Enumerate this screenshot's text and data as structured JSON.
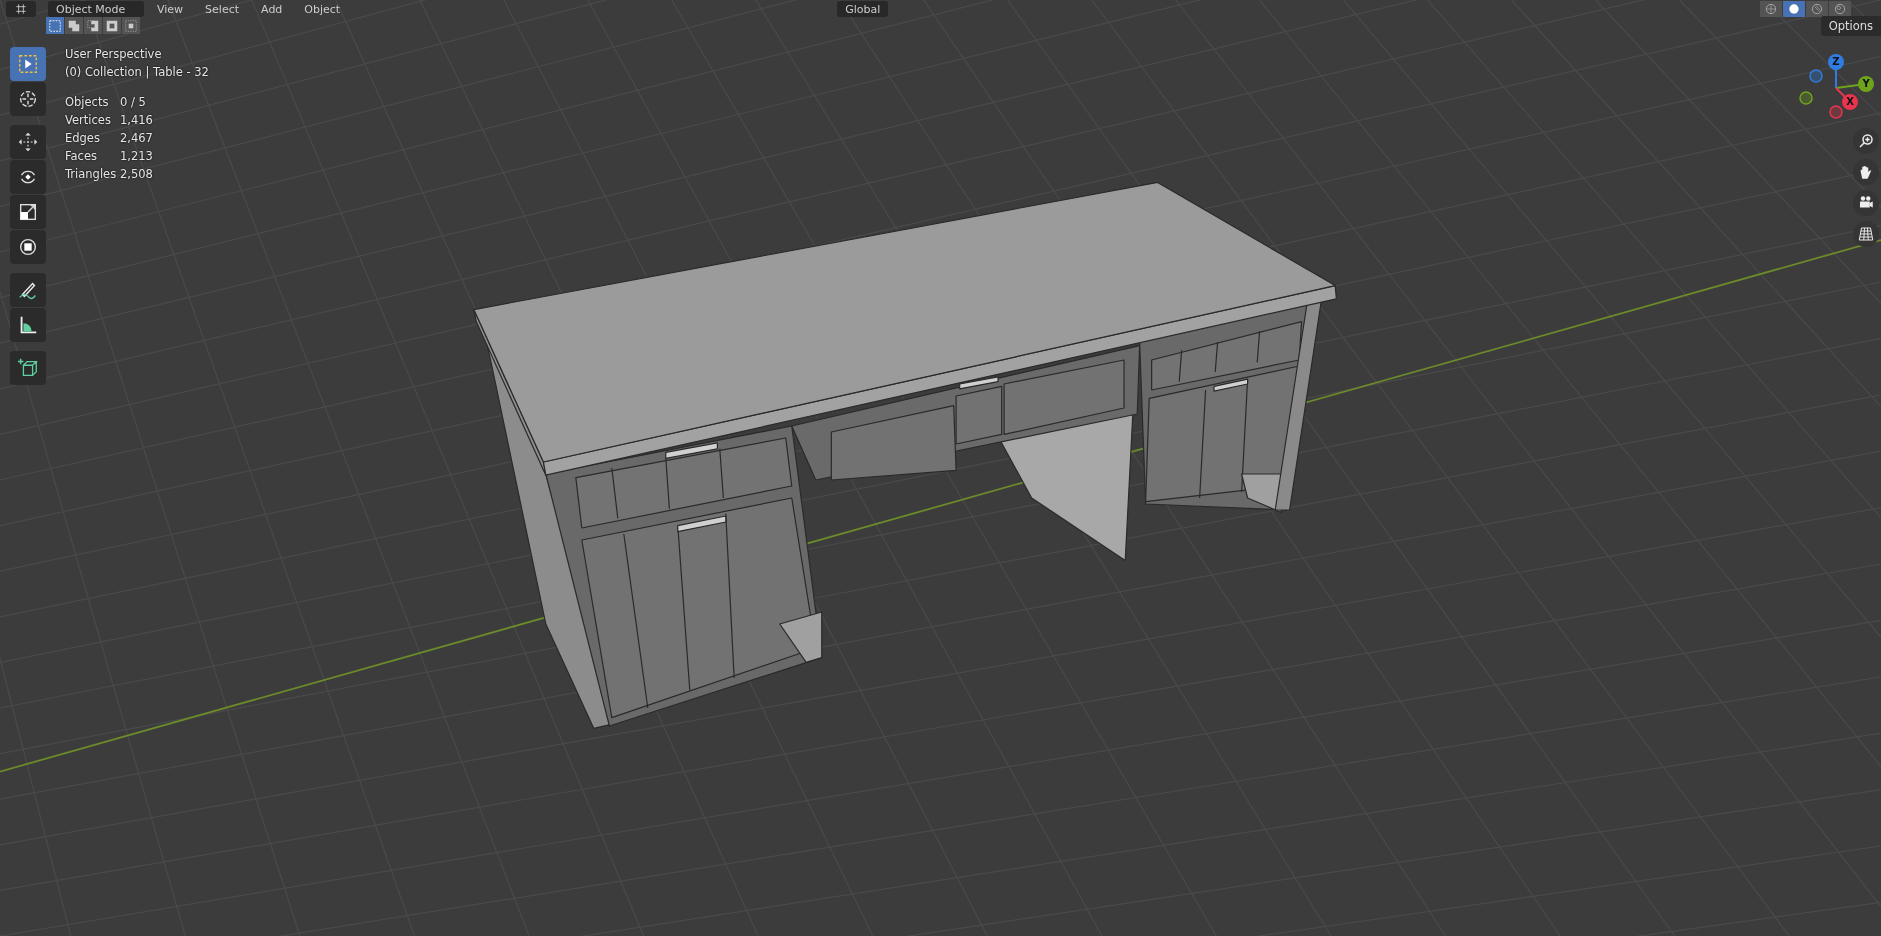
{
  "header": {
    "mode": "Object Mode",
    "menus": [
      "View",
      "Select",
      "Add",
      "Object"
    ],
    "orientation": "Global",
    "shading": [
      {
        "kind": "wire",
        "selected": false
      },
      {
        "kind": "solid",
        "selected": true
      },
      {
        "kind": "material",
        "selected": false
      },
      {
        "kind": "rendered",
        "selected": false
      }
    ]
  },
  "select_modes": [
    {
      "kind": "set",
      "selected": true
    },
    {
      "kind": "extend",
      "selected": false
    },
    {
      "kind": "subtract",
      "selected": false
    },
    {
      "kind": "invert",
      "selected": false
    },
    {
      "kind": "intersect",
      "selected": false
    }
  ],
  "toolbar": [
    {
      "kind": "select",
      "selected": true
    },
    {
      "kind": "cursor",
      "selected": false
    },
    {
      "kind": "move",
      "selected": false
    },
    {
      "kind": "rotate",
      "selected": false
    },
    {
      "kind": "scale",
      "selected": false
    },
    {
      "kind": "transform",
      "selected": false
    },
    {
      "kind": "annotate",
      "selected": false
    },
    {
      "kind": "measure",
      "selected": false
    },
    {
      "kind": "add_cube",
      "selected": false
    }
  ],
  "overlay": {
    "view": "User Perspective",
    "collection": "(0) Collection | Table - 32",
    "stats": [
      {
        "label": "Objects",
        "value": "0 / 5"
      },
      {
        "label": "Vertices",
        "value": "1,416"
      },
      {
        "label": "Edges",
        "value": "2,467"
      },
      {
        "label": "Faces",
        "value": "1,213"
      },
      {
        "label": "Triangles",
        "value": "2,508"
      }
    ]
  },
  "options": "Options",
  "gizmo": {
    "axes": [
      {
        "label": "Z",
        "color": "#2f7de1"
      },
      {
        "label": "Y",
        "color": "#6ea31c"
      },
      {
        "label": "X",
        "color": "#e8344f"
      }
    ]
  },
  "navigation": [
    {
      "kind": "zoom"
    },
    {
      "kind": "pan"
    },
    {
      "kind": "camera"
    },
    {
      "kind": "grid"
    }
  ]
}
